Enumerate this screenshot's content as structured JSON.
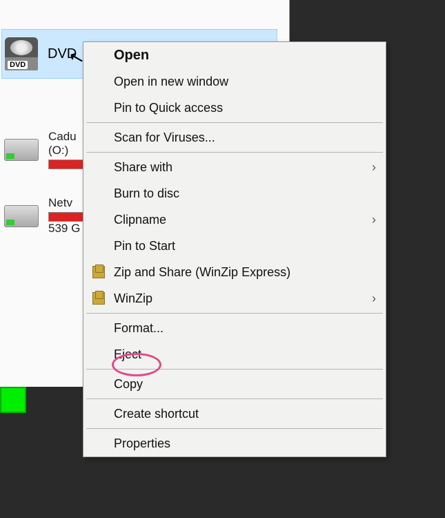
{
  "drives": {
    "selected": {
      "label": "DVD",
      "badge": "DVD"
    },
    "one": {
      "label1": "Cadu",
      "label2": "(O:)"
    },
    "two": {
      "label1": "Netv",
      "label2": "539 G"
    }
  },
  "menu": {
    "open": "Open",
    "open_new_window": "Open in new window",
    "pin_quick": "Pin to Quick access",
    "scan_virus": "Scan for Viruses...",
    "share_with": "Share with",
    "burn": "Burn to disc",
    "clipname": "Clipname",
    "pin_start": "Pin to Start",
    "zip_share": "Zip and Share (WinZip Express)",
    "winzip": "WinZip",
    "format": "Format...",
    "eject": "Eject",
    "copy": "Copy",
    "create_shortcut": "Create shortcut",
    "properties": "Properties"
  }
}
